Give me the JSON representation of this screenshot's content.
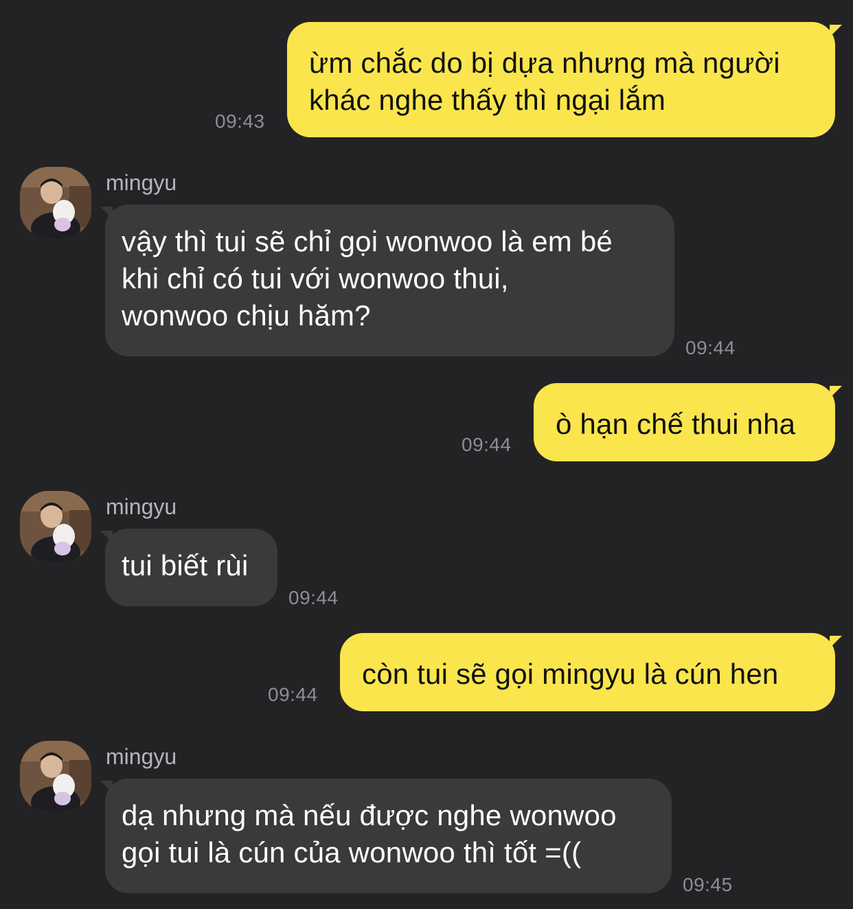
{
  "messages": [
    {
      "from": "me",
      "text": "ừm chắc do bị dựa nhưng mà người\nkhác nghe thấy thì ngại lắm",
      "time": "09:43"
    },
    {
      "from": "mingyu",
      "sender": "mingyu",
      "text": "vậy thì tui sẽ chỉ gọi wonwoo là em bé\nkhi chỉ có tui với wonwoo thui,\nwonwoo chịu hăm?",
      "time": "09:44"
    },
    {
      "from": "me",
      "text": "ò hạn chế thui nha",
      "time": "09:44"
    },
    {
      "from": "mingyu",
      "sender": "mingyu",
      "text": "tui biết rùi",
      "time": "09:44"
    },
    {
      "from": "me",
      "text": "còn tui sẽ gọi mingyu là cún hen",
      "time": "09:44"
    },
    {
      "from": "mingyu",
      "sender": "mingyu",
      "text": "dạ nhưng mà nếu được nghe wonwoo\ngọi tui là cún của wonwoo thì tốt =((",
      "time": "09:45"
    }
  ],
  "colors": {
    "background": "#232325",
    "outgoing_bubble": "#FAE54D",
    "incoming_bubble": "#3A3A3C",
    "timestamp": "#8E8E93"
  },
  "icons": {
    "avatar": "profile-photo"
  }
}
